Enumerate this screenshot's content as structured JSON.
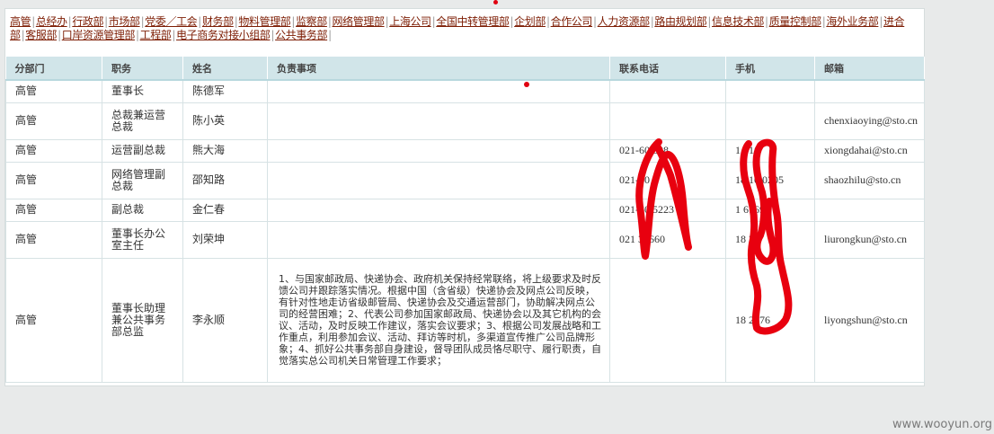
{
  "nav_links": [
    "高管",
    "总经办",
    "行政部",
    "市场部",
    "党委／工会",
    "财务部",
    "物料管理部",
    "监察部",
    "网络管理部",
    "上海公司",
    "全国中转管理部",
    "企划部",
    "合作公司",
    "人力资源部",
    "路由规划部",
    "信息技术部",
    "质量控制部",
    "海外业务部",
    "进合部",
    "客服部",
    "口岸资源管理部",
    "工程部",
    "电子商务对接小组部",
    "公共事务部"
  ],
  "nav_separator": "|",
  "table": {
    "headers": [
      "分部门",
      "职务",
      "姓名",
      "负责事项",
      "联系电话",
      "手机",
      "邮箱"
    ],
    "rows": [
      {
        "dept": "高管",
        "title": "董事长",
        "name": "陈德军",
        "duty": "",
        "phone": "",
        "mobile": "",
        "email": ""
      },
      {
        "dept": "高管",
        "title": "总裁兼运营总裁",
        "name": "陈小英",
        "duty": "",
        "phone": "",
        "mobile": "",
        "email": "chenxiaoying@sto.cn"
      },
      {
        "dept": "高管",
        "title": "运营副总裁",
        "name": "熊大海",
        "duty": "",
        "phone": "021-60   888",
        "mobile": "1   616",
        "email": "xiongdahai@sto.cn"
      },
      {
        "dept": "高管",
        "title": "网络管理副总裁",
        "name": "邵知路",
        "duty": "",
        "phone": "021-60   6",
        "mobile": "18   10   0205",
        "email": "shaozhilu@sto.cn"
      },
      {
        "dept": "高管",
        "title": "副总裁",
        "name": "金仁春",
        "duty": "",
        "phone": "021-60   5223",
        "mobile": "1   6169",
        "email": ""
      },
      {
        "dept": "高管",
        "title": "董事长办公室主任",
        "name": "刘荣坤",
        "duty": "",
        "phone": "021   37660",
        "mobile": "18   26",
        "email": "liurongkun@sto.cn"
      },
      {
        "dept": "高管",
        "title": "董事长助理兼公共事务部总监",
        "name": "李永顺",
        "duty": "1、与国家邮政局、快递协会、政府机关保持经常联络，将上级要求及时反馈公司并跟踪落实情况。根据中国（含省级）快递协会及网点公司反映，有针对性地走访省级邮管局、快递协会及交通运营部门，协助解决网点公司的经营困难；2、代表公司参加国家邮政局、快递协会以及其它机构的会议、活动，及时反映工作建议，落实会议要求；3、根据公司发展战略和工作重点，利用参加会议、活动、拜访等时机，多渠道宣传推广公司品牌形象；4、抓好公共事务部自身建设，督导团队成员恪尽职守、履行职责，自觉落实总公司机关日常管理工作要求；",
        "phone": "",
        "mobile": "18   2476",
        "email": "liyongshun@sto.cn"
      }
    ]
  },
  "watermark": "www.wooyun.org",
  "colors": {
    "link": "#7d1d04",
    "header_bg": "#d1e5e9",
    "redaction": "#e8000f"
  }
}
